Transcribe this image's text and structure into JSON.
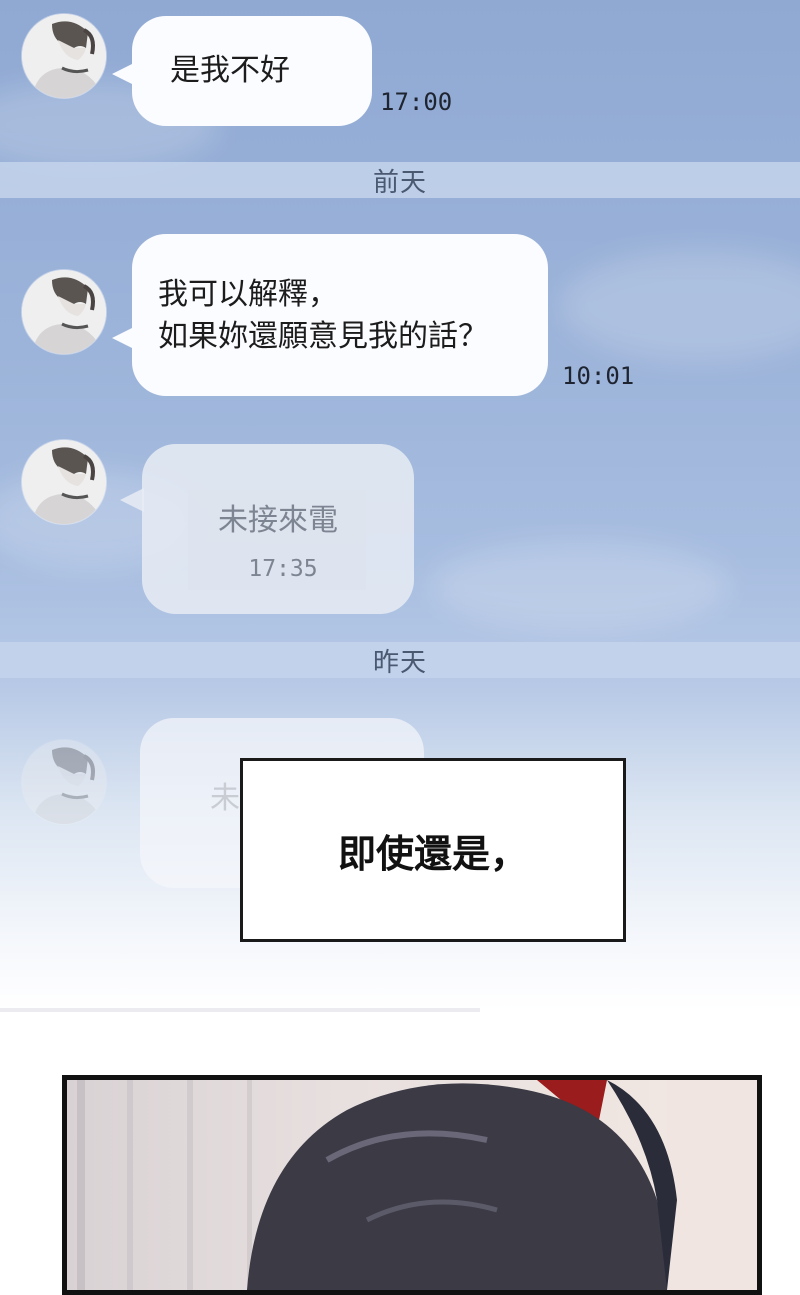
{
  "messages": [
    {
      "text": "是我不好",
      "time": "17:00"
    },
    {
      "line1": "我可以解釋，",
      "line2": "如果妳還願意見我的話？",
      "time": "10:01"
    },
    {
      "missed_label": "未接來電",
      "missed_time": "17:35"
    },
    {
      "faded_label": "未"
    }
  ],
  "separators": {
    "day_before_yesterday": "前天",
    "yesterday": "昨天"
  },
  "caption": "即使還是，",
  "colors": {
    "sky": "#9db4da",
    "bubble": "#fbfcff",
    "separator": "#c4d4ec"
  }
}
